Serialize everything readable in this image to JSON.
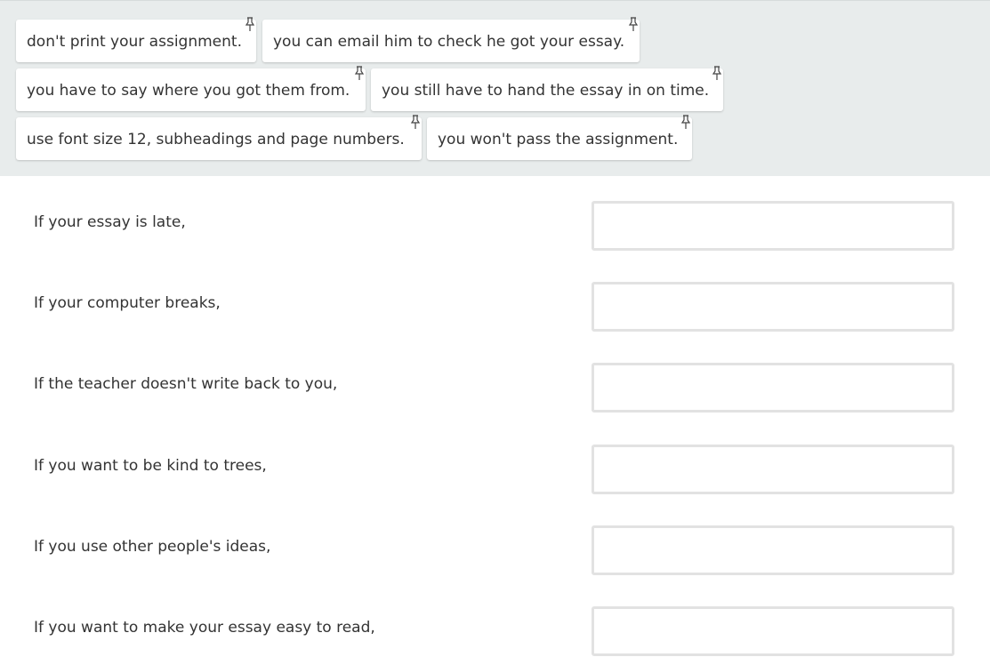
{
  "word_bank": {
    "chips": [
      {
        "text": "don't print your assignment.",
        "icon": "pin-icon"
      },
      {
        "text": "you can email him to check he got your essay.",
        "icon": "pin-icon"
      },
      {
        "text": "you have to say where you got them from.",
        "icon": "pin-icon"
      },
      {
        "text": "you still have to hand the essay in on time.",
        "icon": "pin-icon"
      },
      {
        "text": "use font size 12, subheadings and page numbers.",
        "icon": "pin-icon"
      },
      {
        "text": "you won't pass the assignment.",
        "icon": "pin-icon"
      }
    ]
  },
  "prompts": [
    {
      "text": "If your essay is late,",
      "answer": ""
    },
    {
      "text": "If your computer breaks,",
      "answer": ""
    },
    {
      "text": "If the teacher doesn't write back to you,",
      "answer": ""
    },
    {
      "text": "If you want to be kind to trees,",
      "answer": ""
    },
    {
      "text": "If you use other people's ideas,",
      "answer": ""
    },
    {
      "text": "If you want to make your essay easy to read,",
      "answer": ""
    }
  ],
  "colors": {
    "bank_background": "#e8ecec",
    "chip_background": "#ffffff",
    "dropbox_border": "#e2e2e2",
    "text": "#333333"
  }
}
